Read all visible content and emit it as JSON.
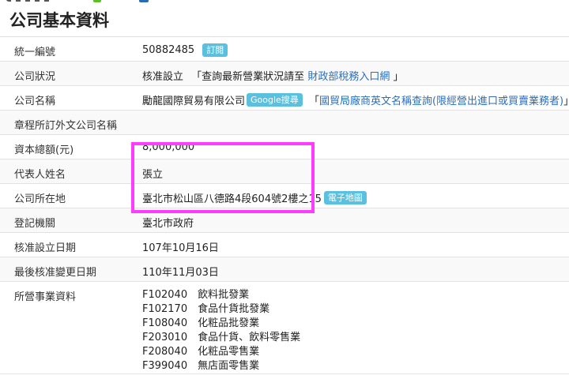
{
  "page": {
    "title": "公司基本資料"
  },
  "rows": {
    "tax_id": {
      "label": "統一編號",
      "value": "50882485",
      "badge": "訂閱"
    },
    "status": {
      "label": "公司狀況",
      "value": "核准設立",
      "note_prefix": "「查詢最新營業狀況請至",
      "link": "財政部稅務入口網",
      "note_suffix": "」"
    },
    "name": {
      "label": "公司名稱",
      "value": "勵龍國際貿易有限公司",
      "badge": "Google搜尋",
      "note_prefix": "「",
      "link": "國貿局廠商英文名稱查詢(限經營出進口或買賣業務者)",
      "note_suffix": "」"
    },
    "foreign_name": {
      "label": "章程所訂外文公司名稱",
      "value": ""
    },
    "capital": {
      "label": "資本總額(元)",
      "value": "8,000,000"
    },
    "representative": {
      "label": "代表人姓名",
      "value": "張立"
    },
    "address": {
      "label": "公司所在地",
      "value": "臺北市松山區八德路4段604號2樓之15",
      "badge": "電子地圖"
    },
    "authority": {
      "label": "登記機關",
      "value": "臺北市政府"
    },
    "approved_date": {
      "label": "核准設立日期",
      "value": "107年10月16日"
    },
    "changed_date": {
      "label": "最後核准變更日期",
      "value": "110年11月03日"
    },
    "business": {
      "label": "所營事業資料",
      "items": [
        "F102040　飲料批發業",
        "F102170　食品什貨批發業",
        "F108040　化粧品批發業",
        "F203010　食品什貨、飲料零售業",
        "F208040　化粧品零售業",
        "F399040　無店面零售業"
      ]
    }
  },
  "colors": {
    "highlight": "#ff3cff",
    "badge": "#5bc0de",
    "link": "#2a6ebb"
  }
}
